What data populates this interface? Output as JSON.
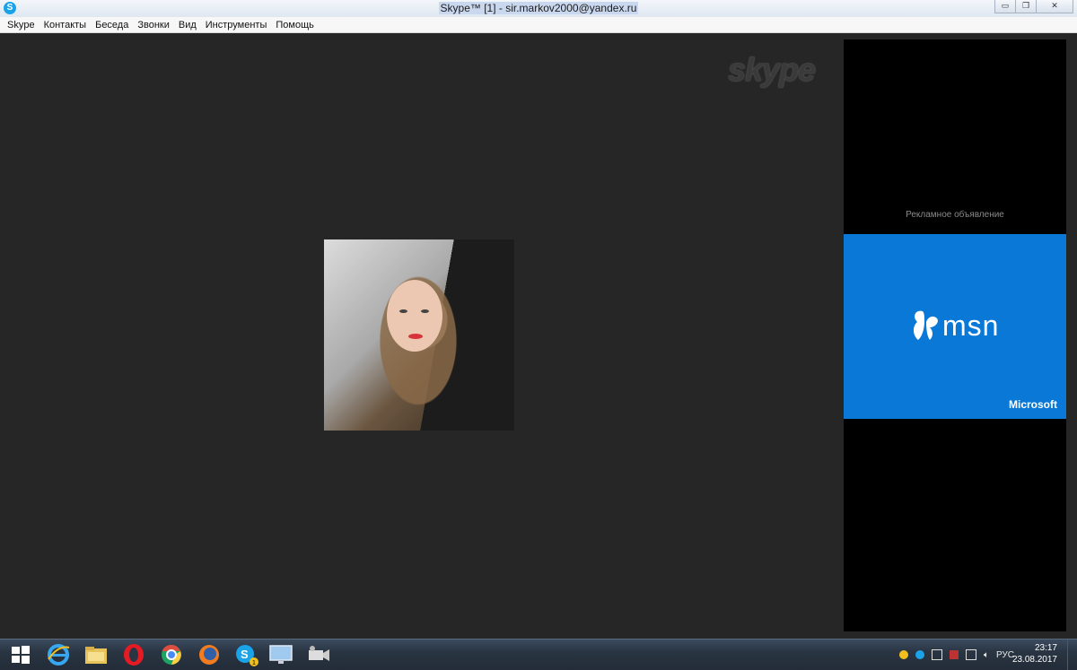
{
  "window": {
    "title": "Skype™ [1] - sir.markov2000@yandex.ru",
    "minimize": "▭",
    "restore": "❐",
    "close": "✕"
  },
  "menu": [
    "Skype",
    "Контакты",
    "Беседа",
    "Звонки",
    "Вид",
    "Инструменты",
    "Помощь"
  ],
  "call": {
    "watermark": "skype",
    "avatar_icon": "user-photo"
  },
  "ad": {
    "label": "Рекламное объявление",
    "brand": "msn",
    "company": "Microsoft",
    "color": "#0a78d7"
  },
  "taskbar": {
    "apps": [
      "start-icon",
      "internet-explorer-icon",
      "file-explorer-icon",
      "opera-icon",
      "chrome-icon",
      "firefox-icon",
      "skype-icon",
      "monitor-icon",
      "camera-icon"
    ],
    "language": "РУС",
    "time": "23:17",
    "date": "23.08.2017"
  }
}
